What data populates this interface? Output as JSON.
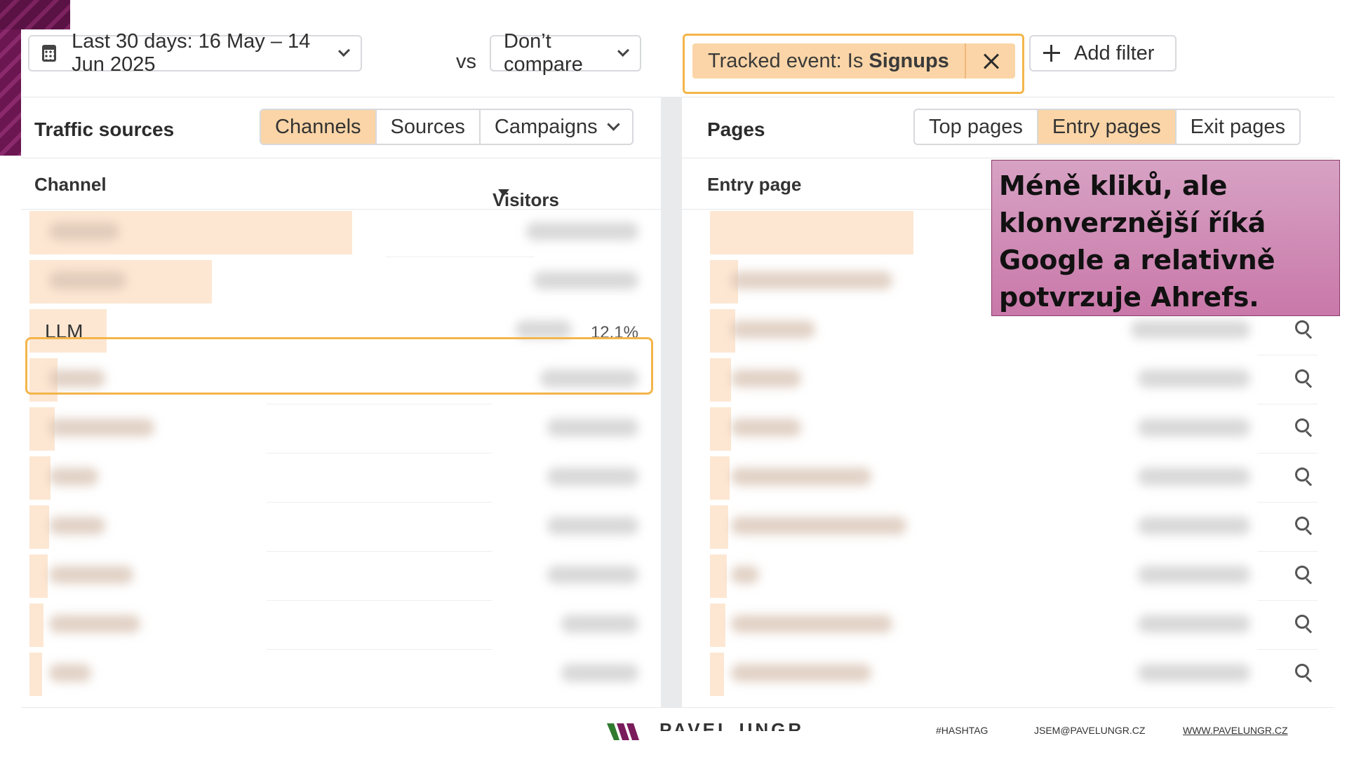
{
  "topbar": {
    "date_range": "Last 30 days: 16 May – 14 Jun 2025",
    "vs": "vs",
    "compare": "Don’t compare",
    "filter_prefix": "Tracked event: Is ",
    "filter_value": "Signups",
    "add_filter": "Add filter"
  },
  "left": {
    "title": "Traffic sources",
    "tabs": [
      "Channels",
      "Sources",
      "Campaigns"
    ],
    "active_tab": "Channels",
    "col_channel": "Channel",
    "col_visitors": "Visitors",
    "highlight_row": {
      "label": "LLM",
      "percent": "12.1%"
    }
  },
  "right": {
    "title": "Pages",
    "tabs": [
      "Top pages",
      "Entry pages",
      "Exit pages"
    ],
    "active_tab": "Entry pages",
    "col_page": "Entry page"
  },
  "annotation": {
    "text": "Méně kliků, ale klonverznější říká Google a relativně potvrzuje Ahrefs."
  },
  "footer": {
    "brand": "PAVEL UNGR",
    "hashtag": "#HASHTAG",
    "email": "JSEM@PAVELUNGR.CZ",
    "web": "WWW.PAVELUNGR.CZ"
  },
  "colors": {
    "accent": "#f4b54a",
    "active_tab": "#fbd5a7",
    "bar": "#fde7d3",
    "annotation": "#cf8bb5"
  }
}
